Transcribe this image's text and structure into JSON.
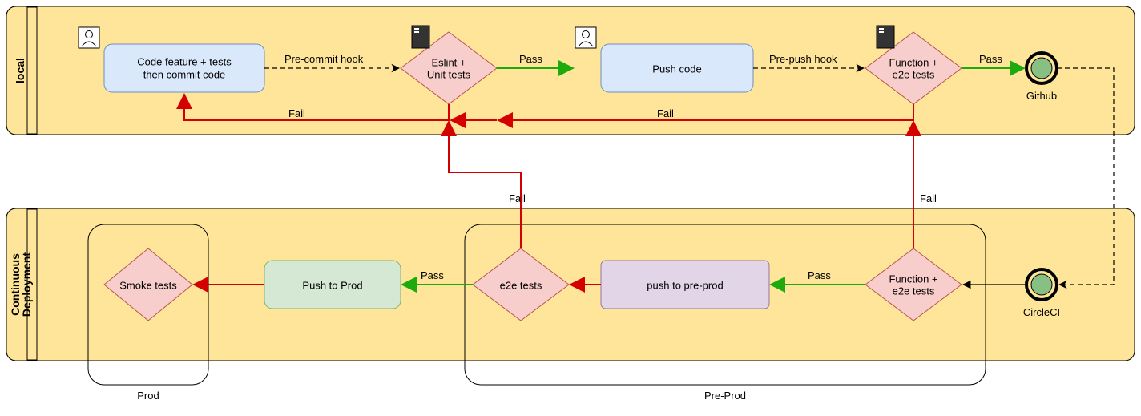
{
  "lanes": {
    "local": "local",
    "cd": "Continuous\nDeployment"
  },
  "local": {
    "codeFeature": "Code feature + tests\nthen commit code",
    "eslint": "Eslint +\nUnit tests",
    "pushCode": "Push code",
    "funcE2e": "Function +\ne2e tests",
    "github": "Github"
  },
  "cd": {
    "circleci": "CircleCI",
    "funcE2e": "Function +\ne2e tests",
    "pushPreprod": "push to pre-prod",
    "e2e": "e2e tests",
    "pushProd": "Push to Prod",
    "smoke": "Smoke tests",
    "captions": {
      "preprod": "Pre-Prod",
      "prod": "Prod"
    }
  },
  "edges": {
    "preCommit": "Pre-commit hook",
    "prePush": "Pre-push hook",
    "pass": "Pass",
    "fail": "Fail"
  }
}
